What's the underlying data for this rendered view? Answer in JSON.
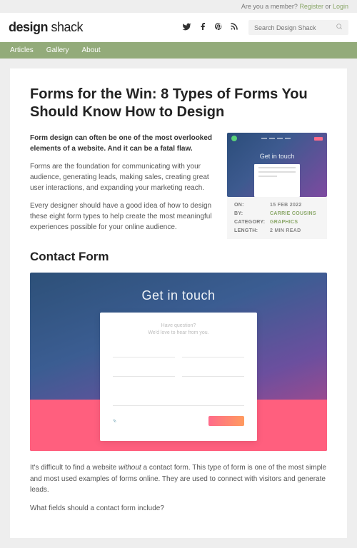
{
  "topbar": {
    "prompt": "Are you a member? ",
    "register": "Register",
    "or": " or ",
    "login": "Login"
  },
  "logo": {
    "part1": "design",
    "part2": " shack"
  },
  "search": {
    "placeholder": "Search Design Shack"
  },
  "nav": {
    "items": [
      "Articles",
      "Gallery",
      "About"
    ]
  },
  "article": {
    "title": "Forms for the Win: 8 Types of Forms You Should Know How to Design",
    "lede": "Form design can often be one of the most overlooked elements of a website. And it can be a fatal flaw.",
    "p2": "Forms are the foundation for communicating with your audience, generating leads, making sales, creating great user interactions, and expanding your marketing reach.",
    "p3": "Every designer should have a good idea of how to design these eight form types to help create the most meaningful experiences possible for your online audience.",
    "h2": "Contact Form",
    "body1_a": "It's difficult to find a website ",
    "body1_em": "without",
    "body1_b": " a contact form. This type of form is one of the most simple and most used examples of forms online. They are used to connect with visitors and generate leads.",
    "body2": "What fields should a contact form include?"
  },
  "meta": {
    "on_label": "ON:",
    "on_val": "15 FEB 2022",
    "by_label": "BY:",
    "by_val": "CARRIE COUSINS",
    "cat_label": "CATEGORY:",
    "cat_val": "GRAPHICS",
    "len_label": "LENGTH:",
    "len_val": "2 MIN READ"
  },
  "thumb": {
    "title": "Get in touch"
  },
  "bigimg": {
    "title": "Get in touch",
    "sub1": "Have question?",
    "sub2": "We'd love to hear from you."
  }
}
